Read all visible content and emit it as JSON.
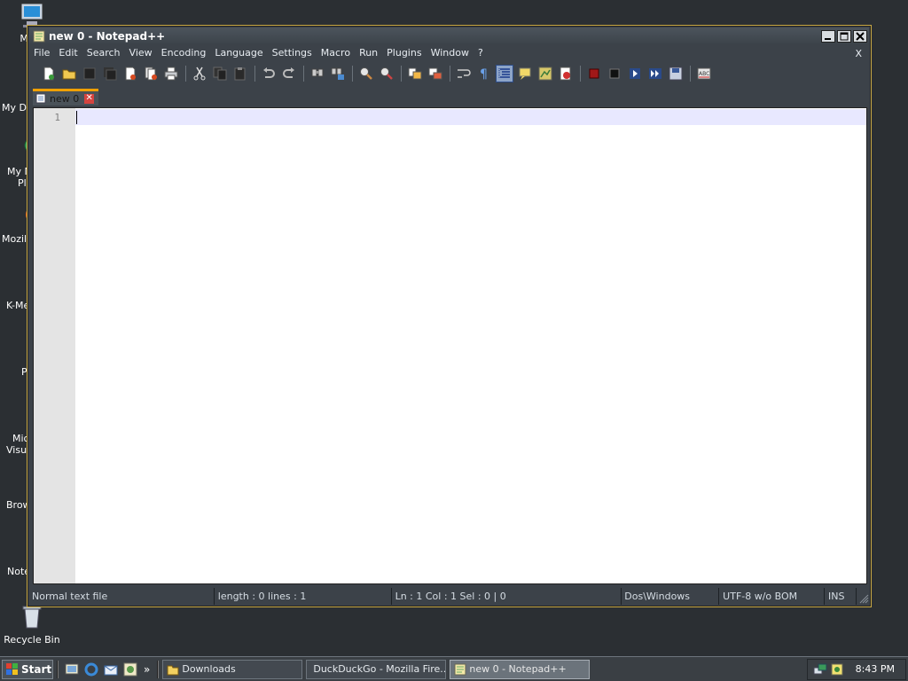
{
  "desktop": {
    "icons": [
      {
        "label": "My C",
        "icon": "computer-icon"
      },
      {
        "label": "My Do",
        "icon": "documents-folder-icon"
      },
      {
        "label": "My N",
        "label2": "Pl",
        "icon": "network-places-icon"
      },
      {
        "label": "Mozill",
        "icon": "firefox-icon"
      },
      {
        "label": "K-Me",
        "icon": "k-meleon-icon"
      },
      {
        "label": "P",
        "icon": "program-shortcut-icon"
      },
      {
        "label": "Mic",
        "label2": "Visua",
        "icon": "visual-studio-icon"
      },
      {
        "label": "Brow",
        "icon": "browser-icon"
      },
      {
        "label": "Note",
        "icon": "notepad-icon"
      },
      {
        "label": "Recycle Bin",
        "icon": "recycle-bin-icon"
      }
    ]
  },
  "window": {
    "title": "new  0 - Notepad++",
    "menu": [
      "File",
      "Edit",
      "Search",
      "View",
      "Encoding",
      "Language",
      "Settings",
      "Macro",
      "Run",
      "Plugins",
      "Window",
      "?"
    ],
    "menu_close": "X",
    "tab": {
      "label": "new  0",
      "close": "✕"
    },
    "editor": {
      "line_numbers": [
        "1"
      ],
      "content": ""
    },
    "status": {
      "file_type": "Normal text file",
      "length": "length : 0    lines : 1",
      "position": "Ln : 1    Col : 1    Sel : 0 | 0",
      "eol": "Dos\\Windows",
      "encoding": "UTF-8 w/o BOM",
      "mode": "INS"
    }
  },
  "taskbar": {
    "start": "Start",
    "more": "»",
    "tasks": [
      {
        "label": "Downloads",
        "icon": "folder-icon",
        "active": false
      },
      {
        "label": "DuckDuckGo - Mozilla Fire...",
        "icon": "firefox-icon",
        "active": false
      },
      {
        "label": "new  0 - Notepad++",
        "icon": "notepad-plus-plus-icon",
        "active": true
      }
    ],
    "clock": "8:43 PM"
  }
}
